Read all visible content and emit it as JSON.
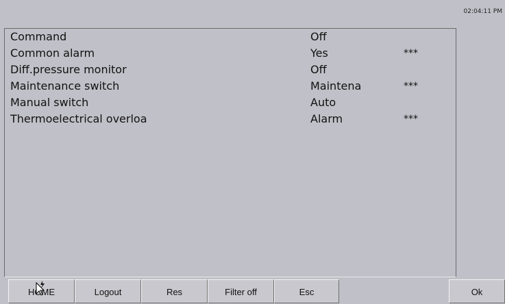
{
  "clock": "02:04:11 PM",
  "rows": [
    {
      "name": "Command",
      "value": "Off",
      "mark": ""
    },
    {
      "name": "Common alarm",
      "value": "Yes",
      "mark": "***"
    },
    {
      "name": "Diff.pressure monitor",
      "value": "Off",
      "mark": ""
    },
    {
      "name": "Maintenance switch",
      "value": "Maintena",
      "mark": "***"
    },
    {
      "name": "Manual switch",
      "value": "Auto",
      "mark": ""
    },
    {
      "name": "Thermoelectrical overloa",
      "value": "Alarm",
      "mark": "***"
    }
  ],
  "buttons": {
    "home": "HOME",
    "logout": "Logout",
    "res": "Res",
    "filter": "Filter off",
    "esc": "Esc",
    "blank": "",
    "ok": "Ok"
  }
}
